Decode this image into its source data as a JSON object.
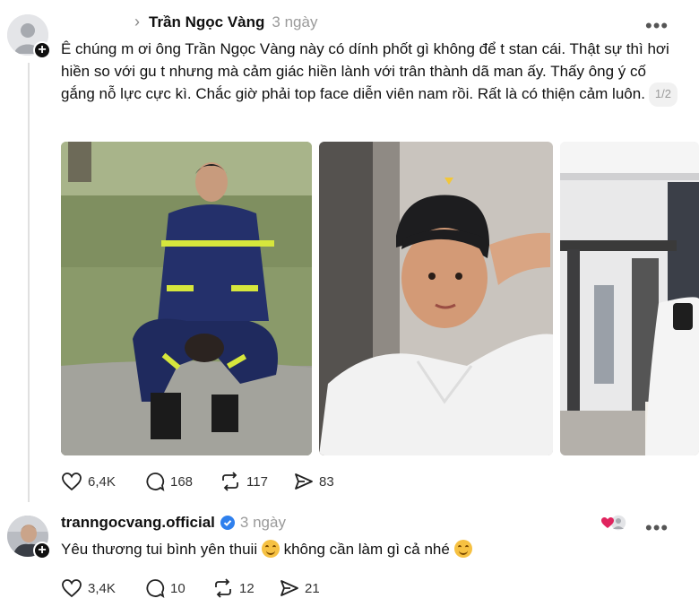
{
  "post": {
    "author": "Trần Ngọc Vàng",
    "reply_arrow": "›",
    "time": "3 ngày",
    "more": "•••",
    "text": "Ê chúng m ơi ông Trần Ngọc Vàng này có dính phốt gì không để t stan cái. Thật sự thì hơi hiền so với gu t nhưng mà cảm giác hiền lành với trân thành dã man ấy. Thấy ông ý cố gắng nỗ lực cực kì. Chắc giờ phải top face diễn viên nam rồi. Rất là có thiện cảm luôn.",
    "pager": "1/2",
    "actions": {
      "likes": "6,4K",
      "comments": "168",
      "reposts": "117",
      "shares": "83"
    }
  },
  "reply": {
    "author": "tranngocvang.official",
    "time": "3 ngày",
    "more": "•••",
    "text_part1": "Yêu thương tui bình yên thuii",
    "text_part2": "không cần làm gì cả nhé",
    "actions": {
      "likes": "3,4K",
      "comments": "10",
      "reposts": "12",
      "shares": "21"
    }
  },
  "colors": {
    "verified": "#2f80ed",
    "heart_red": "#e0245e",
    "muted": "#9a9a9a"
  }
}
